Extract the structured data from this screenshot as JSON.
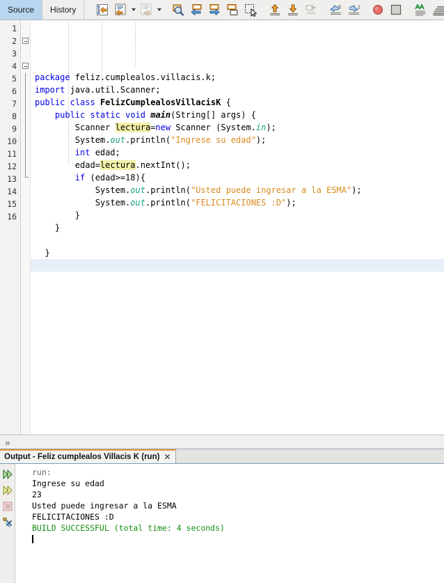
{
  "view_tabs": [
    {
      "label": "Source",
      "selected": true
    },
    {
      "label": "History",
      "selected": false
    }
  ],
  "toolbar": {
    "groups": [
      {
        "buttons": [
          {
            "name": "last-edit-icon",
            "title": "Last Edit"
          },
          {
            "name": "back-icon",
            "title": "Back",
            "dropdown": true
          },
          {
            "name": "forward-icon",
            "title": "Forward",
            "dropdown": true,
            "disabled": true
          }
        ]
      },
      {
        "buttons": [
          {
            "name": "find-selection-icon",
            "title": "Find Selection"
          },
          {
            "name": "find-previous-icon",
            "title": "Find Previous"
          },
          {
            "name": "find-next-icon",
            "title": "Find Next"
          },
          {
            "name": "toggle-highlight-icon",
            "title": "Toggle Highlight Search"
          },
          {
            "name": "toggle-rectangular-selection-icon",
            "title": "Toggle Rectangular Selection"
          }
        ]
      },
      {
        "buttons": [
          {
            "name": "previous-bookmark-icon",
            "title": "Previous Bookmark"
          },
          {
            "name": "next-bookmark-icon",
            "title": "Next Bookmark"
          },
          {
            "name": "toggle-bookmark-icon",
            "title": "Toggle Bookmark"
          }
        ]
      },
      {
        "buttons": [
          {
            "name": "shift-left-icon",
            "title": "Shift Line Left"
          },
          {
            "name": "shift-right-icon",
            "title": "Shift Line Right"
          }
        ]
      },
      {
        "buttons": [
          {
            "name": "toggle-breakpoint-icon",
            "title": "Toggle Breakpoint"
          },
          {
            "name": "stop-icon",
            "title": "Stop"
          }
        ]
      },
      {
        "buttons": [
          {
            "name": "inspect-icon",
            "title": "Inspect"
          },
          {
            "name": "format-icon",
            "title": "Format"
          }
        ]
      }
    ]
  },
  "editor": {
    "current_line": 16,
    "line_numbers": [
      1,
      2,
      3,
      4,
      5,
      6,
      7,
      8,
      9,
      10,
      11,
      12,
      13,
      14,
      15,
      16
    ],
    "fold_lines": [
      2,
      4
    ],
    "lines": [
      "package feliz.cumplealos.villacis.k;",
      "import java.util.Scanner;",
      "public class FelizCumplealosVillacisK {",
      "    public static void main(String[] args) {",
      "        Scanner lectura=new Scanner (System.in);",
      "        System.out.println(\"Ingrese su edad\");",
      "        int edad;",
      "        edad=lectura.nextInt();",
      "        if (edad>=18){",
      "            System.out.println(\"Usted puede ingresar a la ESMA\");",
      "            System.out.println(\"FELICITACIONES :D\");",
      "        }",
      "    }",
      "",
      "  }",
      ""
    ],
    "highlighted_token": "lectura",
    "colors": {
      "keyword": "#0000e6",
      "string": "#d98b20",
      "field": "#16a085",
      "highlight": "#f2efa8",
      "current_line": "#e8eef7"
    }
  },
  "mini_panel": {
    "chevron": "»"
  },
  "output": {
    "tab_label": "Output - Feliz cumplealos Villacis K (run)",
    "close_label": "✕",
    "side_icons": [
      {
        "name": "rerun-icon",
        "title": "Re-run"
      },
      {
        "name": "rerun-alt-icon",
        "title": "Re-run with different parameters"
      },
      {
        "name": "stop-process-icon",
        "title": "Stop process"
      },
      {
        "name": "output-settings-icon",
        "title": "Output settings"
      }
    ],
    "lines": [
      {
        "text": "run:",
        "style": "dim"
      },
      {
        "text": "Ingrese su edad",
        "style": "normal"
      },
      {
        "text": "23",
        "style": "normal"
      },
      {
        "text": "Usted puede ingresar a la ESMA",
        "style": "normal"
      },
      {
        "text": "FELICITACIONES :D",
        "style": "normal"
      },
      {
        "text": "BUILD SUCCESSFUL (total time: 4 seconds)",
        "style": "ok"
      }
    ],
    "colors": {
      "success": "#128c12",
      "dim": "#666666"
    }
  }
}
